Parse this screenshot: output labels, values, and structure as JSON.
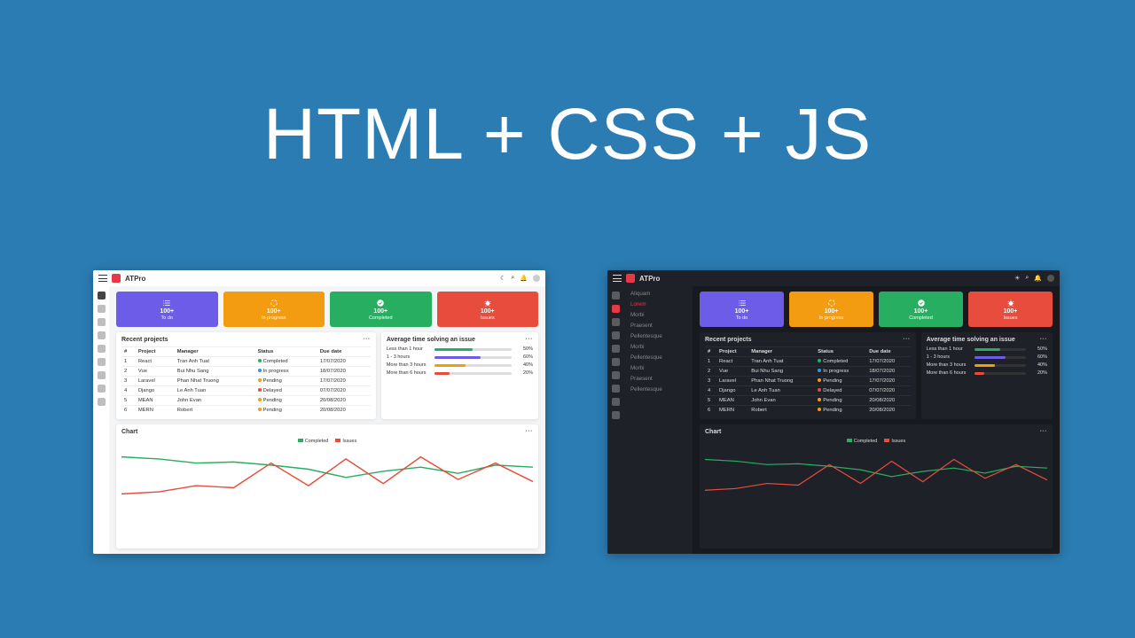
{
  "headline": "HTML + CSS + JS",
  "brand": "ATPro",
  "cards": [
    {
      "value": "100+",
      "label": "To do"
    },
    {
      "value": "100+",
      "label": "In progress"
    },
    {
      "value": "100+",
      "label": "Completed"
    },
    {
      "value": "100+",
      "label": "Issues"
    }
  ],
  "recent": {
    "title": "Recent projects",
    "headers": [
      "#",
      "Project",
      "Manager",
      "Status",
      "Due date"
    ],
    "rows": [
      {
        "n": "1",
        "project": "React",
        "manager": "Tran Anh Tuat",
        "status": "Completed",
        "dot": "d-g",
        "due": "17/07/2020"
      },
      {
        "n": "2",
        "project": "Vue",
        "manager": "Bui Nhu Sang",
        "status": "In progress",
        "dot": "d-b",
        "due": "18/07/2020"
      },
      {
        "n": "3",
        "project": "Laravel",
        "manager": "Phan Nhat Truong",
        "status": "Pending",
        "dot": "d-o",
        "due": "17/07/2020"
      },
      {
        "n": "4",
        "project": "Django",
        "manager": "Le Anh Tuan",
        "status": "Delayed",
        "dot": "d-r",
        "due": "07/07/2020"
      },
      {
        "n": "5",
        "project": "MEAN",
        "manager": "John Evan",
        "status": "Pending",
        "dot": "d-o",
        "due": "20/08/2020"
      },
      {
        "n": "6",
        "project": "MERN",
        "manager": "Robert",
        "status": "Pending",
        "dot": "d-o",
        "due": "20/08/2020"
      }
    ]
  },
  "avg": {
    "title": "Average time solving an issue",
    "rows": [
      {
        "label": "Less than 1 hour",
        "pct": 50,
        "color": "#27ae60"
      },
      {
        "label": "1 - 3 hours",
        "pct": 60,
        "color": "#6c5ce7"
      },
      {
        "label": "More than 3 hours",
        "pct": 40,
        "color": "#f39c12"
      },
      {
        "label": "More than 6 hours",
        "pct": 20,
        "color": "#e74c3c"
      }
    ]
  },
  "chart_title": "Chart",
  "chart_legend": [
    "Completed",
    "Issues"
  ],
  "dark_sidebar": [
    "Aliquam",
    "Lorem",
    "Morbi",
    "Praesent",
    "Pellentesque",
    "Morbi",
    "Pellentesque",
    "Morbi",
    "Praesent",
    "Pellentesque"
  ],
  "chart_data": {
    "type": "line",
    "x": [
      1,
      2,
      3,
      4,
      5,
      6,
      7,
      8,
      9,
      10,
      11,
      12
    ],
    "ylim": [
      0,
      250
    ],
    "series": [
      {
        "name": "Completed",
        "color": "#27ae60",
        "values": [
          200,
          190,
          170,
          175,
          160,
          140,
          100,
          130,
          150,
          120,
          160,
          150
        ]
      },
      {
        "name": "Issues",
        "color": "#e74c3c",
        "values": [
          20,
          30,
          60,
          50,
          170,
          60,
          190,
          70,
          200,
          90,
          170,
          80
        ]
      }
    ]
  }
}
